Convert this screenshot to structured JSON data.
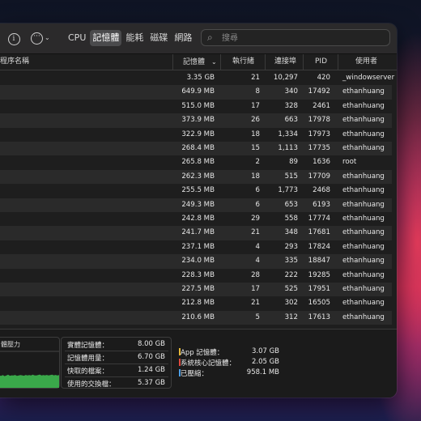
{
  "toolbar": {
    "tabs": [
      "CPU",
      "記憶體",
      "能耗",
      "磁碟",
      "網路"
    ],
    "active_tab": 1,
    "search_placeholder": "搜尋"
  },
  "table": {
    "columns": [
      "程序名稱",
      "記憶體",
      "執行緒",
      "連接埠",
      "PID",
      "使用者"
    ],
    "sort_indicator": "⌄",
    "rows": [
      {
        "memory": "3.35 GB",
        "threads": "21",
        "ports": "10,297",
        "pid": "420",
        "user": "_windowserver"
      },
      {
        "memory": "649.9 MB",
        "threads": "8",
        "ports": "340",
        "pid": "17492",
        "user": "ethanhuang"
      },
      {
        "memory": "515.0 MB",
        "threads": "17",
        "ports": "328",
        "pid": "2461",
        "user": "ethanhuang"
      },
      {
        "memory": "373.9 MB",
        "threads": "26",
        "ports": "663",
        "pid": "17978",
        "user": "ethanhuang"
      },
      {
        "memory": "322.9 MB",
        "threads": "18",
        "ports": "1,334",
        "pid": "17973",
        "user": "ethanhuang"
      },
      {
        "memory": "268.4 MB",
        "threads": "15",
        "ports": "1,113",
        "pid": "17735",
        "user": "ethanhuang"
      },
      {
        "memory": "265.8 MB",
        "threads": "2",
        "ports": "89",
        "pid": "1636",
        "user": "root"
      },
      {
        "memory": "262.3 MB",
        "threads": "18",
        "ports": "515",
        "pid": "17709",
        "user": "ethanhuang"
      },
      {
        "memory": "255.5 MB",
        "threads": "6",
        "ports": "1,773",
        "pid": "2468",
        "user": "ethanhuang"
      },
      {
        "memory": "249.3 MB",
        "threads": "6",
        "ports": "653",
        "pid": "6193",
        "user": "ethanhuang"
      },
      {
        "memory": "242.8 MB",
        "threads": "29",
        "ports": "558",
        "pid": "17774",
        "user": "ethanhuang"
      },
      {
        "memory": "241.7 MB",
        "threads": "21",
        "ports": "348",
        "pid": "17681",
        "user": "ethanhuang"
      },
      {
        "memory": "237.1 MB",
        "threads": "4",
        "ports": "293",
        "pid": "17824",
        "user": "ethanhuang"
      },
      {
        "memory": "234.0 MB",
        "threads": "4",
        "ports": "335",
        "pid": "18847",
        "user": "ethanhuang"
      },
      {
        "memory": "228.3 MB",
        "threads": "28",
        "ports": "222",
        "pid": "19285",
        "user": "ethanhuang"
      },
      {
        "memory": "227.5 MB",
        "threads": "17",
        "ports": "525",
        "pid": "17951",
        "user": "ethanhuang"
      },
      {
        "memory": "212.8 MB",
        "threads": "21",
        "ports": "302",
        "pid": "16505",
        "user": "ethanhuang"
      },
      {
        "memory": "210.6 MB",
        "threads": "5",
        "ports": "312",
        "pid": "17613",
        "user": "ethanhuang"
      }
    ]
  },
  "footer": {
    "pressure_label": "體壓力",
    "pressure_history": [
      0.55,
      0.6,
      0.58,
      0.62,
      0.57,
      0.6,
      0.64,
      0.59,
      0.61,
      0.6,
      0.63,
      0.58,
      0.6,
      0.62,
      0.61,
      0.59,
      0.63,
      0.6,
      0.62,
      0.6,
      0.64,
      0.61,
      0.6,
      0.62,
      0.65,
      0.6,
      0.62,
      0.61,
      0.63,
      0.6,
      0.62,
      0.64,
      0.61,
      0.63,
      0.6,
      0.62
    ],
    "stats": [
      {
        "label": "實體記憶體：",
        "value": "8.00 GB"
      },
      {
        "label": "記憶體用量：",
        "value": "6.70 GB"
      },
      {
        "label": "快取的檔案：",
        "value": "1.24 GB"
      },
      {
        "label": "使用的交換檔：",
        "value": "5.37 GB"
      }
    ],
    "breakdown": [
      {
        "label": "App 記憶體：",
        "value": "3.07 GB"
      },
      {
        "label": "系統核心記憶體：",
        "value": "2.05 GB"
      },
      {
        "label": "已壓縮：",
        "value": "958.1 MB"
      }
    ],
    "colors": {
      "app": "#e5b93a",
      "wired": "#e0483d",
      "compressed": "#4da0e8",
      "pressure": "#3aa84a"
    }
  }
}
